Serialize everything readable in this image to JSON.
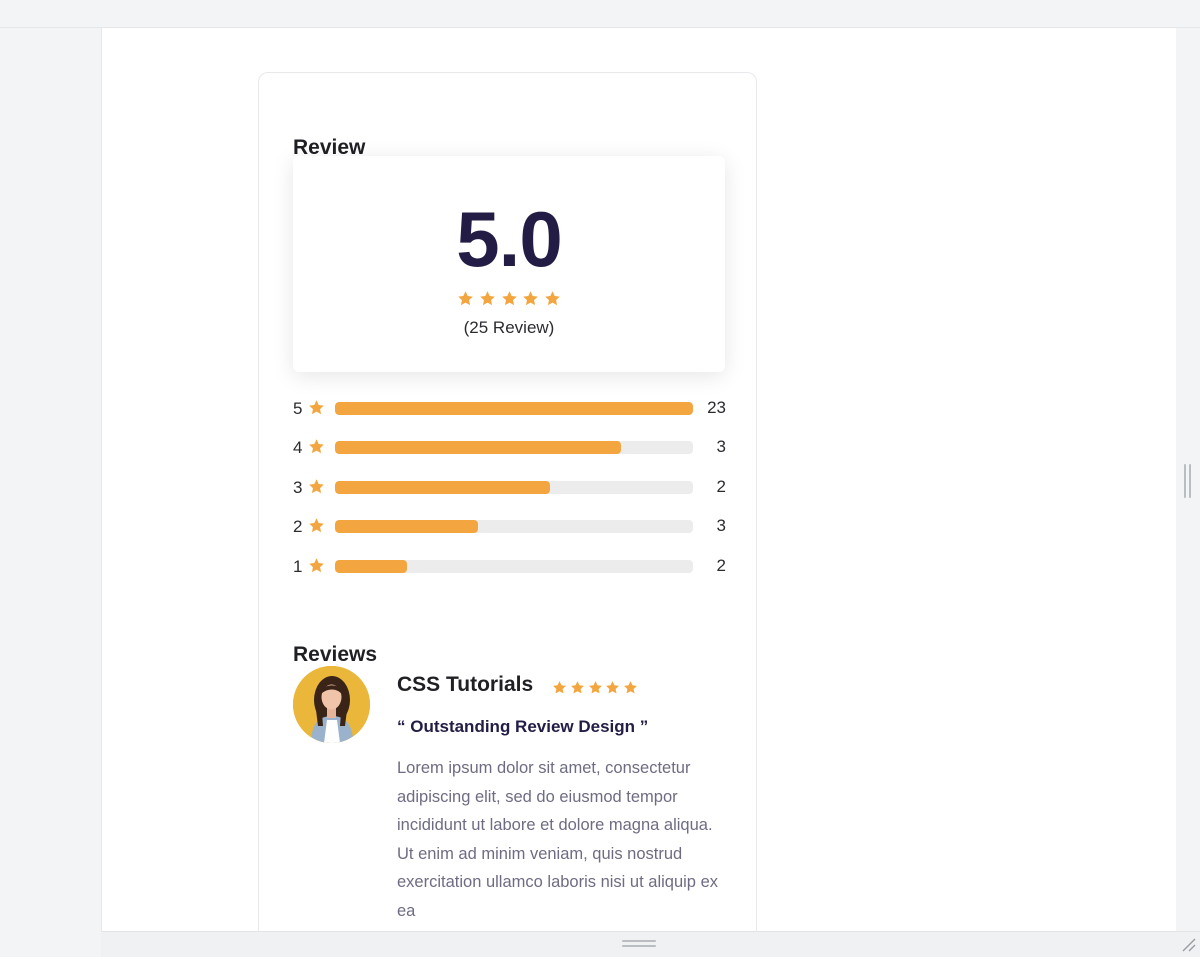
{
  "review_title": "Review",
  "summary": {
    "average": "5.0",
    "count_label": "(25 Review)",
    "stars": 5
  },
  "breakdown": [
    {
      "stars": "5",
      "count": "23",
      "fill_percent": 100
    },
    {
      "stars": "4",
      "count": "3",
      "fill_percent": 80
    },
    {
      "stars": "3",
      "count": "2",
      "fill_percent": 60
    },
    {
      "stars": "2",
      "count": "3",
      "fill_percent": 40
    },
    {
      "stars": "1",
      "count": "2",
      "fill_percent": 20
    }
  ],
  "reviews_title": "Reviews",
  "review": {
    "name": "CSS Tutorials",
    "stars": 5,
    "headline": "“ Outstanding Review Design ”",
    "text": "Lorem ipsum dolor sit amet, consectetur adipiscing elit, sed do eiusmod tempor incididunt ut labore et dolore magna aliqua. Ut enim ad minim veniam, quis nostrud exercitation ullamco laboris nisi ut aliquip ex ea"
  },
  "colors": {
    "accent": "#f3a63f",
    "score": "#231d45",
    "track": "#ececed",
    "body_text": "#6e6c83"
  },
  "icons": {
    "star": "star-icon",
    "avatar": "user-avatar"
  }
}
